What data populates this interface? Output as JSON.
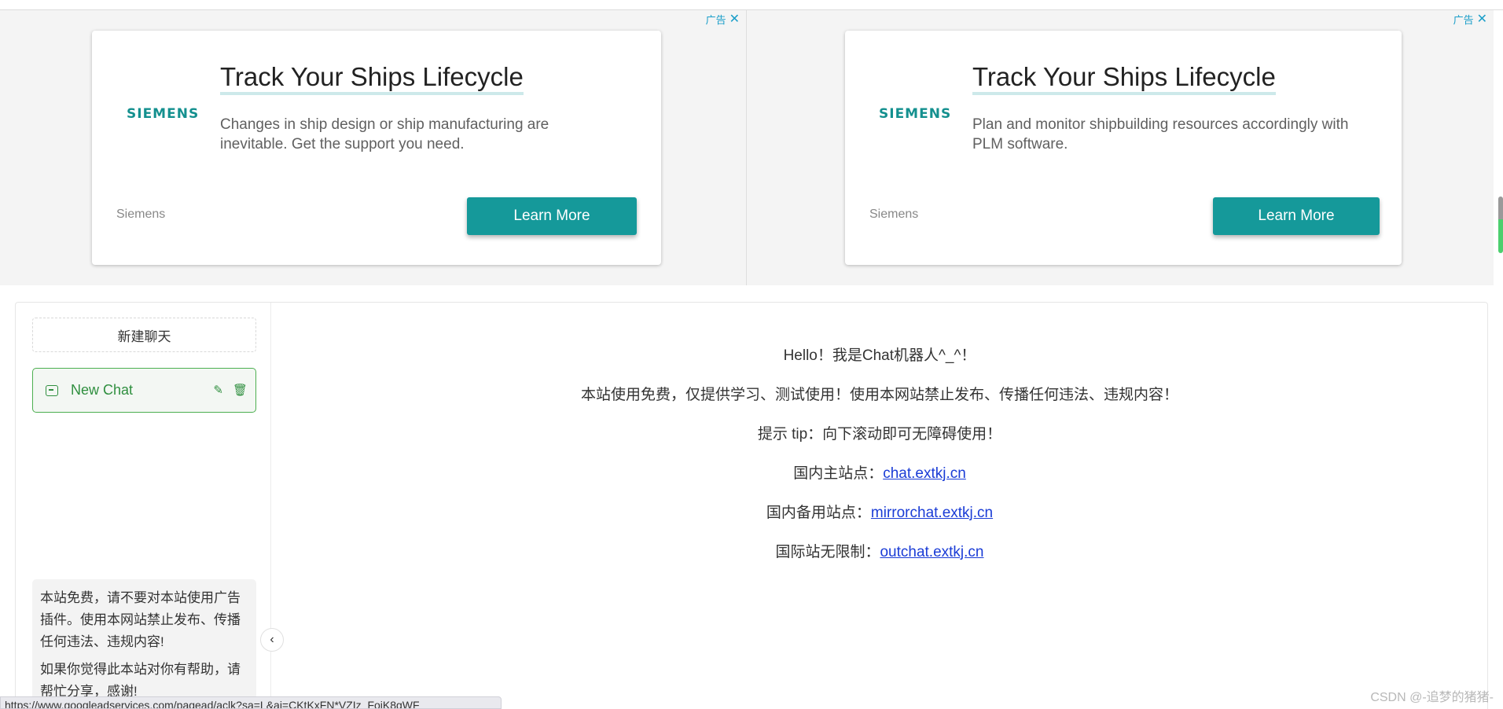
{
  "ads": [
    {
      "tag_label": "广告",
      "close_symbol": "✕",
      "logo": "SIEMENS",
      "title": "Track Your Ships Lifecycle",
      "description": "Changes in ship design or ship manufacturing are inevitable. Get the support you need.",
      "brand": "Siemens",
      "cta_label": "Learn More"
    },
    {
      "tag_label": "广告",
      "close_symbol": "✕",
      "logo": "SIEMENS",
      "title": "Track Your Ships Lifecycle",
      "description": "Plan and monitor shipbuilding resources accordingly with PLM software.",
      "brand": "Siemens",
      "cta_label": "Learn More"
    }
  ],
  "sidebar": {
    "new_chat_label": "新建聊天",
    "chats": [
      {
        "title": "New Chat",
        "edit_icon": "✎",
        "delete_icon": "🗑"
      }
    ],
    "notice": {
      "paragraph1": "本站免费，请不要对本站使用广告插件。使用本网站禁止发布、传播任何违法、违规内容!",
      "paragraph2": "如果你觉得此本站对你有帮助，请帮忙分享，感谢!"
    },
    "collapse_icon": "‹"
  },
  "welcome": {
    "greeting": "Hello！我是Chat机器人^_^！",
    "free_notice": "本站使用免费，仅提供学习、测试使用！使用本网站禁止发布、传播任何违法、违规内容！",
    "tip": "提示 tip：向下滚动即可无障碍使用！",
    "domestic_main_label": "国内主站点：",
    "domestic_main_link": "chat.extkj.cn",
    "domestic_backup_label": "国内备用站点：",
    "domestic_backup_link": "mirrorchat.extkj.cn",
    "international_label": "国际站无限制：",
    "international_link": "outchat.extkj.cn"
  },
  "status_bar": {
    "url": "https://www.googleadservices.com/pagead/aclk?sa=L&ai=CKtKxFN*VZIz_FojK8gWF"
  },
  "watermark": "CSDN @-追梦的猪猪-",
  "colors": {
    "accent_teal": "#15999a",
    "chat_green": "#4caf50",
    "link_blue": "#1a3cd6"
  }
}
